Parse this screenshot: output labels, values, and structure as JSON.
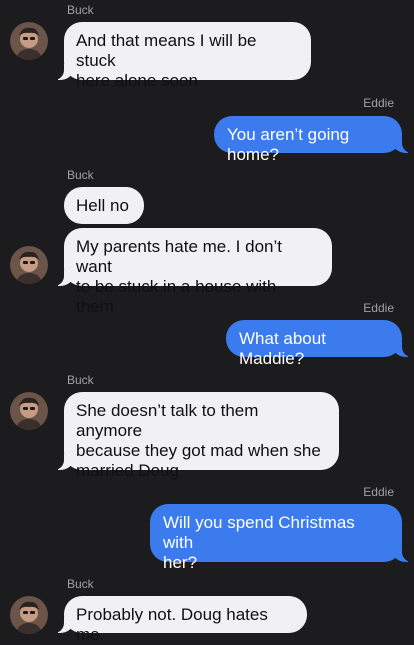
{
  "conversation": {
    "contact_name": "Buck",
    "self_name": "Eddie",
    "messages": [
      {
        "from": "Buck",
        "text": "And that means I will be stuck\nhere alone soon"
      },
      {
        "from": "Eddie",
        "text": "You aren’t going home?"
      },
      {
        "from": "Buck",
        "text": "Hell no"
      },
      {
        "from": "Buck",
        "text": "My parents hate me. I don’t want\nto be stuck in a house with them"
      },
      {
        "from": "Eddie",
        "text": "What about Maddie?"
      },
      {
        "from": "Buck",
        "text": "She doesn’t talk to them anymore\nbecause they got mad when she\nmarried Doug"
      },
      {
        "from": "Eddie",
        "text": "Will you spend Christmas with\nher?"
      },
      {
        "from": "Buck",
        "text": "Probably not. Doug hates me."
      }
    ]
  },
  "colors": {
    "background": "#1c1c1e",
    "incoming_bubble": "#f1f1f4",
    "outgoing_bubble": "#3b7bee",
    "sender_label": "#a1a1a6"
  },
  "icons": {
    "avatar": "contact-photo"
  }
}
